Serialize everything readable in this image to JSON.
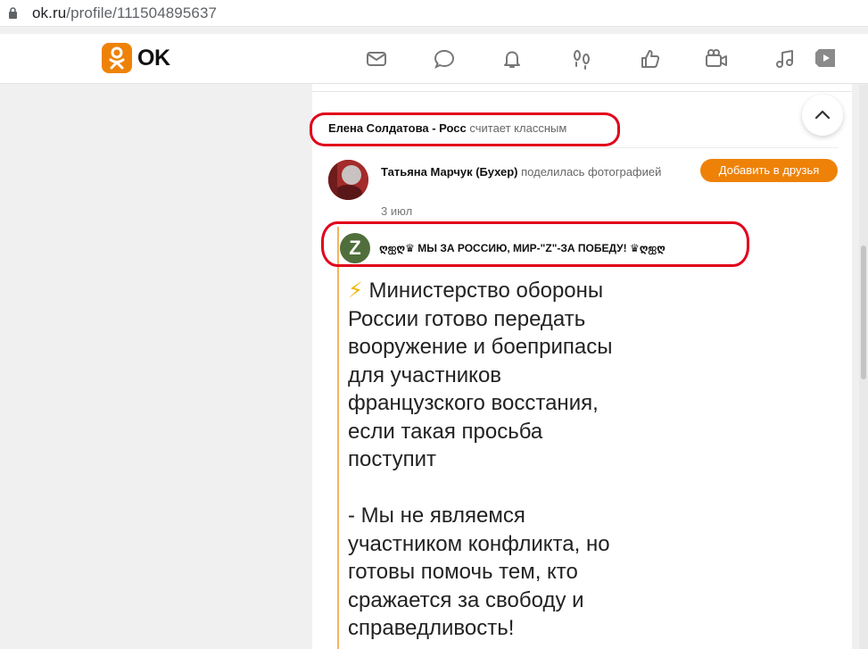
{
  "address_bar": {
    "domain": "ok.ru",
    "path": "/profile/111504895637"
  },
  "topnav": {
    "logo_text": "OK",
    "icons": [
      "mail-icon",
      "chat-icon",
      "bell-icon",
      "footprints-icon",
      "like-icon",
      "video-icon",
      "music-icon",
      "tv-icon"
    ]
  },
  "feed": {
    "action": {
      "actor": "Елена Солдатова - Росс",
      "verb": "считает классным"
    },
    "post": {
      "author": "Татьяна Марчук (Бухер)",
      "action_text": "поделилась фотографией",
      "date": "3 июл",
      "add_friend_label": "Добавить в друзья",
      "group_name": "ღஐღ♛ МЫ ЗА РОССИЮ, МИР-\"Z\"-ЗА ПОБЕДУ! ♛ღஐღ",
      "group_avatar_letter": "Z",
      "image_text": {
        "bolt": "⚡",
        "line1": "Министерство обороны",
        "line2": "России готово передать",
        "line3": "вооружение и боеприпасы",
        "line4": "для участников",
        "line5": "французского восстания,",
        "line6": "если такая просьба",
        "line7": "поступит",
        "line8": "- Мы не являемся",
        "line9": "участником конфликта, но",
        "line10": "готовы помочь тем, кто",
        "line11": "сражается за свободу и",
        "line12": "справедливость!"
      }
    }
  },
  "colors": {
    "accent": "#ee8208",
    "highlight": "#e2001a",
    "reshare_bar": "#f2b45c"
  }
}
